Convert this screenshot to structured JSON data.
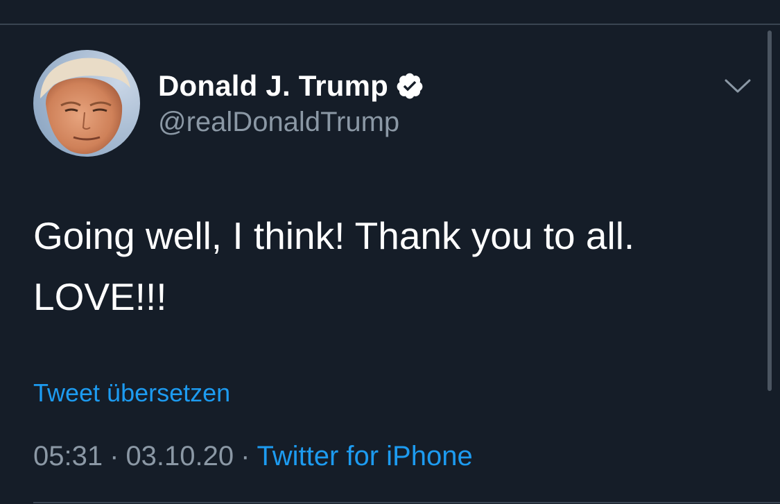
{
  "tweet": {
    "author_name": "Donald J. Trump",
    "handle": "@realDonaldTrump",
    "verified": true,
    "text": "Going well, I think! Thank you to all.\nLOVE!!!",
    "translate_label": "Tweet übersetzen",
    "time": "05:31",
    "date": "03.10.20",
    "source": "Twitter for iPhone",
    "separator": "·"
  },
  "icons": {
    "verified": "verified-badge-icon",
    "menu": "chevron-down-icon"
  },
  "colors": {
    "background": "#151d28",
    "primary_text": "#ffffff",
    "secondary_text": "#8b98a5",
    "link": "#1d9bf0"
  }
}
